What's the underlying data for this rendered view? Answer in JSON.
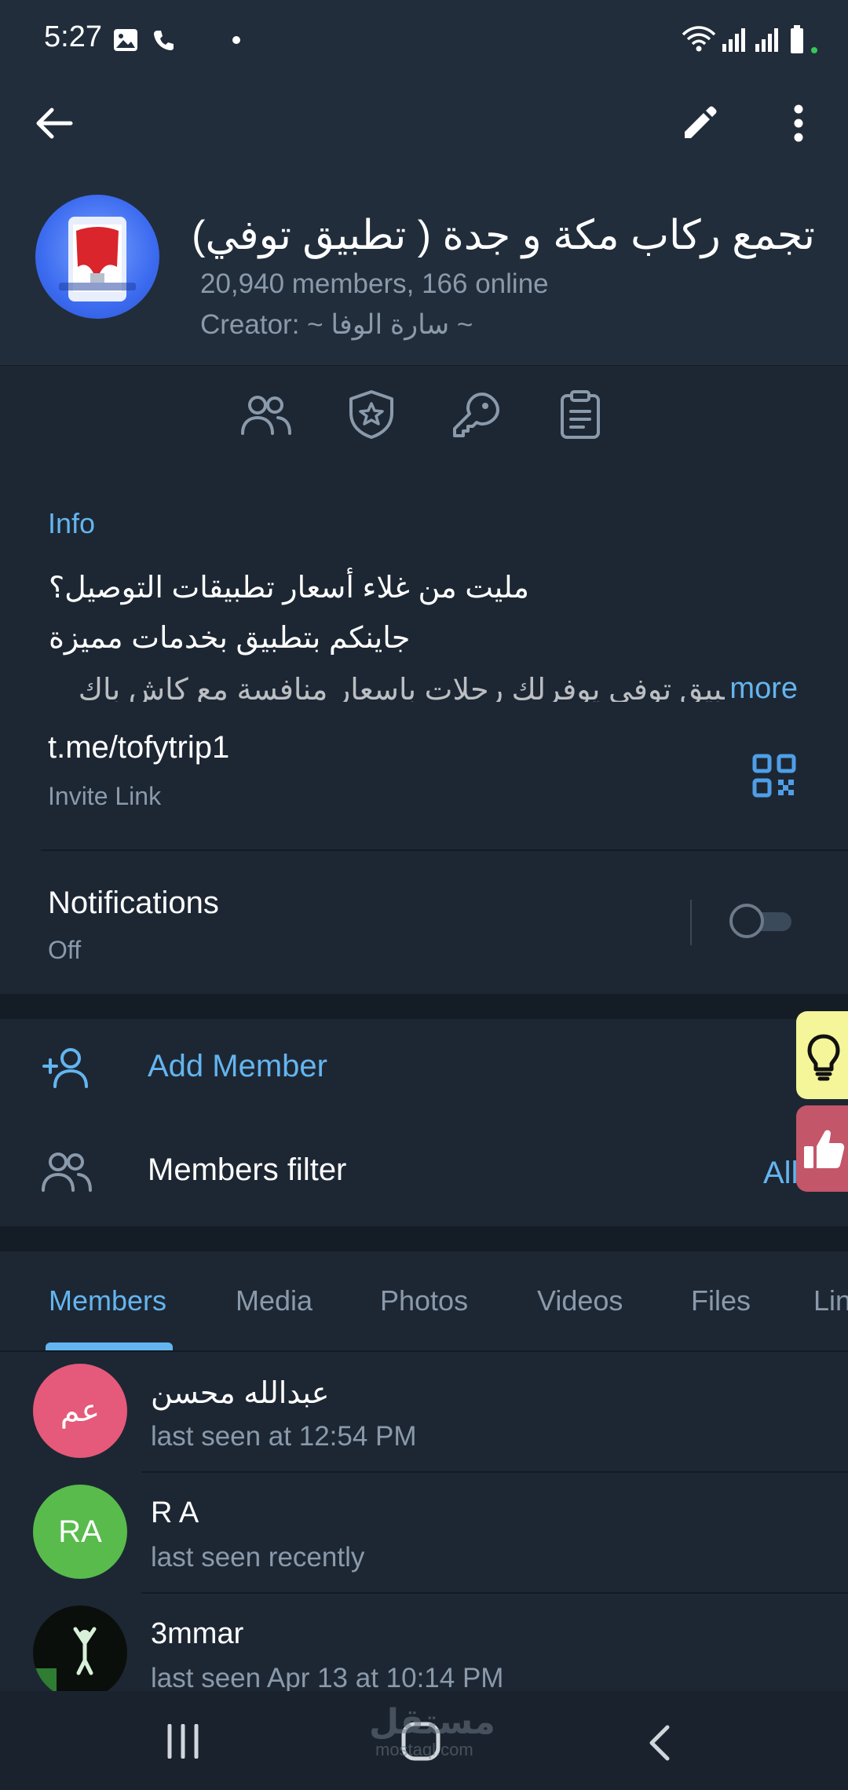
{
  "status_bar": {
    "time": "5:27",
    "left_icons": [
      "gallery-icon",
      "phone-icon",
      "dot-icon"
    ],
    "right_icons": [
      "wifi-icon",
      "signal-icon",
      "signal-icon",
      "battery-icon"
    ]
  },
  "toolbar": {
    "back_icon": "arrow-left-icon",
    "edit_icon": "pencil-icon",
    "more_icon": "more-vertical-icon"
  },
  "group": {
    "title": "تجمع ركاب مكة و جدة ( تطبيق توفي)",
    "subtitle": "20,940 members, 166 online",
    "creator": "Creator: ~ سارة الوفا ~"
  },
  "admin_icons": [
    "members-icon",
    "admins-shield-icon",
    "permissions-key-icon",
    "recent-actions-clipboard-icon"
  ],
  "info": {
    "label": "Info",
    "description_lines": [
      "مليت من غلاء أسعار تطبيقات التوصيل؟",
      "جاينكم بتطبيق بخدمات مميزة",
      "تطبيق توفي يوفرلك رحلات باسعار منافسة مع كاش باك"
    ],
    "more_label": "more",
    "invite_link": "t.me/tofytrip1",
    "invite_label": "Invite Link"
  },
  "notifications": {
    "title": "Notifications",
    "state": "Off",
    "enabled": false
  },
  "actions": {
    "add_member_label": "Add Member",
    "filter_label": "Members filter",
    "filter_value": "All"
  },
  "tabs": [
    {
      "label": "Members",
      "active": true
    },
    {
      "label": "Media",
      "active": false
    },
    {
      "label": "Photos",
      "active": false
    },
    {
      "label": "Videos",
      "active": false
    },
    {
      "label": "Files",
      "active": false
    },
    {
      "label": "Links",
      "active": false
    }
  ],
  "members": [
    {
      "initials": "عم",
      "name": "عبدالله محسن",
      "status": "last seen at 12:54 PM",
      "color": "#e5597a"
    },
    {
      "initials": "RA",
      "name": "R A",
      "status": "last seen recently",
      "color": "#58bb4c"
    },
    {
      "initials": "",
      "name": "3mmar",
      "status": "last seen Apr 13 at 10:14 PM",
      "color": "#0b0f0c"
    }
  ],
  "watermark": {
    "text": "مستقل",
    "sub": "mostaql.com"
  },
  "colors": {
    "background": "#1d2733",
    "header": "#212d3b",
    "accent": "#64b5ef",
    "secondary_text": "#8a9aab"
  }
}
